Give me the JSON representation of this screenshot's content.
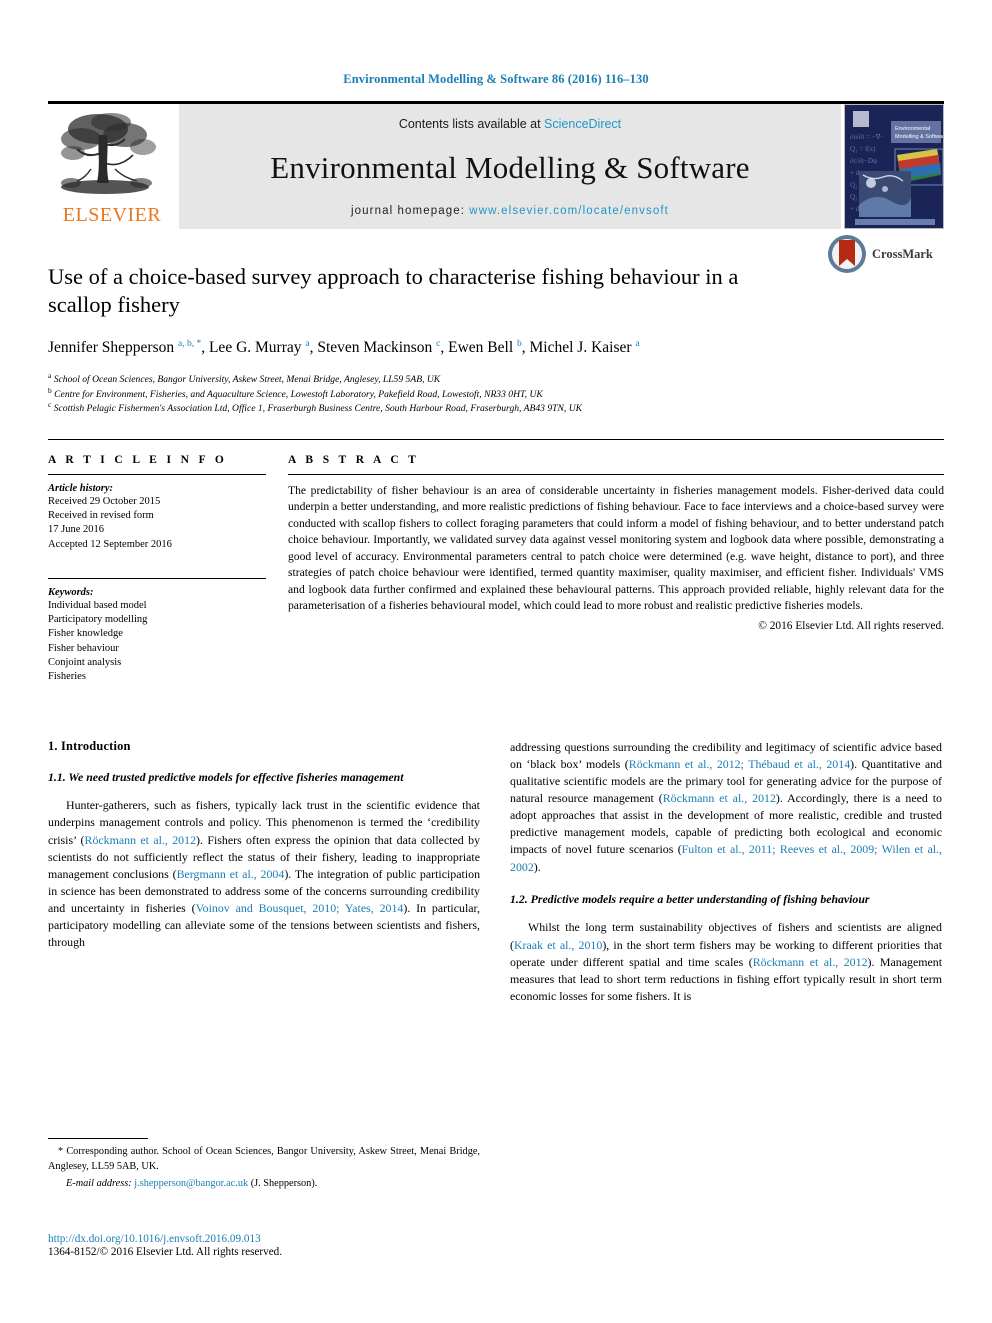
{
  "running_head": "Environmental Modelling & Software 86 (2016) 116–130",
  "masthead": {
    "publisher_name": "ELSEVIER",
    "contents_prefix": "Contents lists available at ",
    "contents_link": "ScienceDirect",
    "journal_name": "Environmental Modelling & Software",
    "homepage_prefix": "journal homepage: ",
    "homepage_url": "www.elsevier.com/locate/envsoft",
    "cover_title": "Environmental Modelling & Software"
  },
  "article": {
    "title": "Use of a choice-based survey approach to characterise fishing behaviour in a scallop fishery",
    "authors_html": "Jennifer Shepperson <sup>a, b, *</sup>, Lee G. Murray <sup>a</sup>, Steven Mackinson <sup>c</sup>, Ewen Bell <sup>b</sup>, Michel J. Kaiser <sup>a</sup>",
    "affiliations": [
      "School of Ocean Sciences, Bangor University, Askew Street, Menai Bridge, Anglesey, LL59 5AB, UK",
      "Centre for Environment, Fisheries, and Aquaculture Science, Lowestoft Laboratory, Pakefield Road, Lowestoft, NR33 0HT, UK",
      "Scottish Pelagic Fishermen's Association Ltd, Office 1, Fraserburgh Business Centre, South Harbour Road, Fraserburgh, AB43 9TN, UK"
    ],
    "affiliation_marks": [
      "a",
      "b",
      "c"
    ],
    "crossmark_label": "CrossMark"
  },
  "article_info": {
    "heading": "A R T I C L E   I N F O",
    "history_label": "Article history:",
    "history_lines": [
      "Received 29 October 2015",
      "Received in revised form",
      "17 June 2016",
      "Accepted 12 September 2016"
    ],
    "keywords_label": "Keywords:",
    "keywords": [
      "Individual based model",
      "Participatory modelling",
      "Fisher knowledge",
      "Fisher behaviour",
      "Conjoint analysis",
      "Fisheries"
    ]
  },
  "abstract": {
    "heading": "A B S T R A C T",
    "text": "The predictability of fisher behaviour is an area of considerable uncertainty in fisheries management models. Fisher-derived data could underpin a better understanding, and more realistic predictions of fishing behaviour. Face to face interviews and a choice-based survey were conducted with scallop fishers to collect foraging parameters that could inform a model of fishing behaviour, and to better understand patch choice behaviour. Importantly, we validated survey data against vessel monitoring system and logbook data where possible, demonstrating a good level of accuracy. Environmental parameters central to patch choice were determined (e.g. wave height, distance to port), and three strategies of patch choice behaviour were identified, termed quantity maximiser, quality maximiser, and efficient fisher. Individuals' VMS and logbook data further confirmed and explained these behavioural patterns. This approach provided reliable, highly relevant data for the parameterisation of a fisheries behavioural model, which could lead to more robust and realistic predictive fisheries models.",
    "copyright": "© 2016 Elsevier Ltd. All rights reserved."
  },
  "body": {
    "section1_heading": "1.  Introduction",
    "section11_heading": "1.1.  We need trusted predictive models for effective fisheries management",
    "para1_part1": "Hunter-gatherers, such as fishers, typically lack trust in the scientific evidence that underpins management controls and policy. This phenomenon is termed the ‘credibility crisis’ (",
    "para1_cite1": "Röckmann et al., 2012",
    "para1_part2": "). Fishers often express the opinion that data collected by scientists do not sufficiently reflect the status of their fishery, leading to inappropriate management conclusions (",
    "para1_cite2": "Bergmann et al., 2004",
    "para1_part3": "). The integration of public participation in science has been demonstrated to address some of the concerns surrounding credibility and uncertainty in fisheries (",
    "para1_cite3": "Voinov and Bousquet, 2010; Yates, 2014",
    "para1_part4": "). In particular, participatory modelling can alleviate some of the tensions between scientists and fishers, through",
    "para2_part1": "addressing questions surrounding the credibility and legitimacy of scientific advice based on ‘black box’ models (",
    "para2_cite1": "Röckmann et al., 2012; Thébaud et al., 2014",
    "para2_part2": "). Quantitative and qualitative scientific models are the primary tool for generating advice for the purpose of natural resource management (",
    "para2_cite2": "Röckmann et al., 2012",
    "para2_part3": "). Accordingly, there is a need to adopt approaches that assist in the development of more realistic, credible and trusted predictive management models, capable of predicting both ecological and economic impacts of novel future scenarios (",
    "para2_cite3": "Fulton et al., 2011; Reeves et al., 2009; Wilen et al., 2002",
    "para2_part4": ").",
    "section12_heading": "1.2.  Predictive models require a better understanding of fishing behaviour",
    "para3_part1": "Whilst the long term sustainability objectives of fishers and scientists are aligned (",
    "para3_cite1": "Kraak et al., 2010",
    "para3_part2": "), in the short term fishers may be working to different priorities that operate under different spatial and time scales (",
    "para3_cite2": "Röckmann et al., 2012",
    "para3_part3": "). Management measures that lead to short term reductions in fishing effort typically result in short term economic losses for some fishers. It is"
  },
  "footnote": {
    "corresponding": "* Corresponding author. School of Ocean Sciences, Bangor University, Askew Street, Menai Bridge, Anglesey, LL59 5AB, UK.",
    "email_label": "E-mail address:",
    "email": "j.shepperson@bangor.ac.uk",
    "email_suffix": "(J. Shepperson)."
  },
  "footer": {
    "doi": "http://dx.doi.org/10.1016/j.envsoft.2016.09.013",
    "issn_line": "1364-8152/© 2016 Elsevier Ltd. All rights reserved."
  },
  "colors": {
    "link_blue": "#1a7fb5",
    "sciencedirect_blue": "#2196c4",
    "elsevier_orange": "#E87722",
    "banner_gray": "#e6e6e6",
    "crossmark_red": "#b52a13",
    "crossmark_blue": "#5d7b99"
  }
}
